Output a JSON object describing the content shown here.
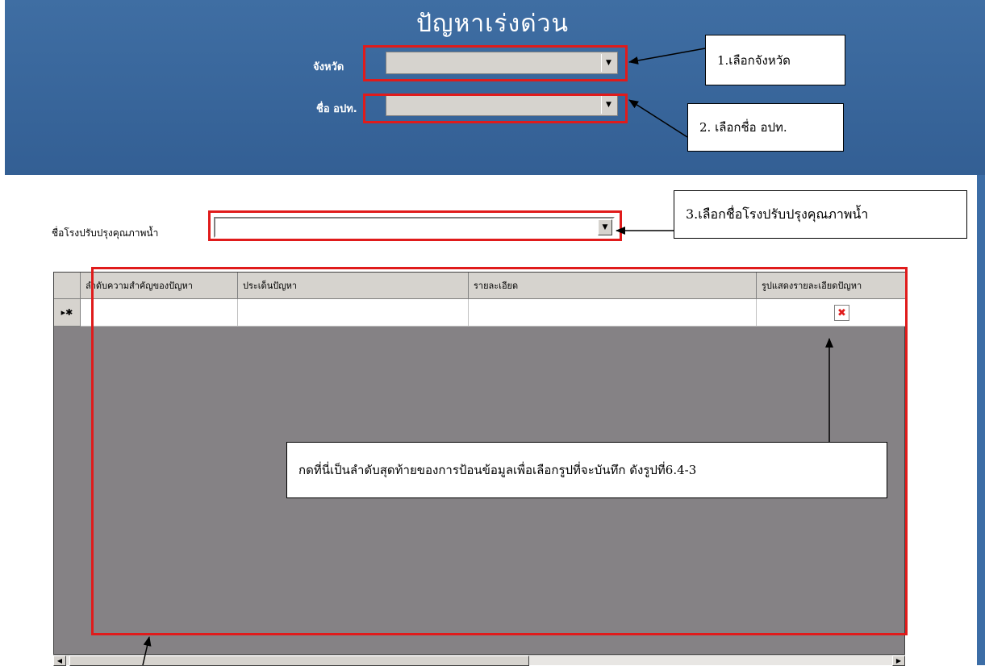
{
  "header": {
    "title": "ปัญหาเร่งด่วน",
    "province_label": "จังหวัด",
    "province_value": "",
    "lao_label": "ชื่อ อปท.",
    "lao_value": ""
  },
  "form": {
    "plant_label": "ชื่อโรงปรับปรุงคุณภาพน้ำ",
    "plant_value": ""
  },
  "grid": {
    "columns": [
      "ลำดับความสำคัญของปัญหา",
      "ประเด็นปัญหา",
      "รายละเอียด",
      "รูปแสดงรายละเอียดปัญหา"
    ],
    "new_row_marker": "▸✱"
  },
  "callouts": {
    "step1": "1.เลือกจังหวัด",
    "step2": "2. เลือกชื่อ อปท.",
    "step3": "3.เลือกชื่อโรงปรับปรุงคุณภาพน้ำ",
    "step4": "กดที่นี่เป็นลำดับสุดท้ายของการป้อนข้อมูลเพื่อเลือกรูปที่จะบันทึก ดังรูปที่6.4-3"
  },
  "icons": {
    "dropdown": "chevron-down-icon",
    "broken_image": "broken-image-icon",
    "scroll_left": "scroll-left-icon",
    "scroll_right": "scroll-right-icon"
  },
  "colors": {
    "header_blue": "#3a68a0",
    "annotation_red": "#e01b1b",
    "grid_gray": "#858285"
  }
}
